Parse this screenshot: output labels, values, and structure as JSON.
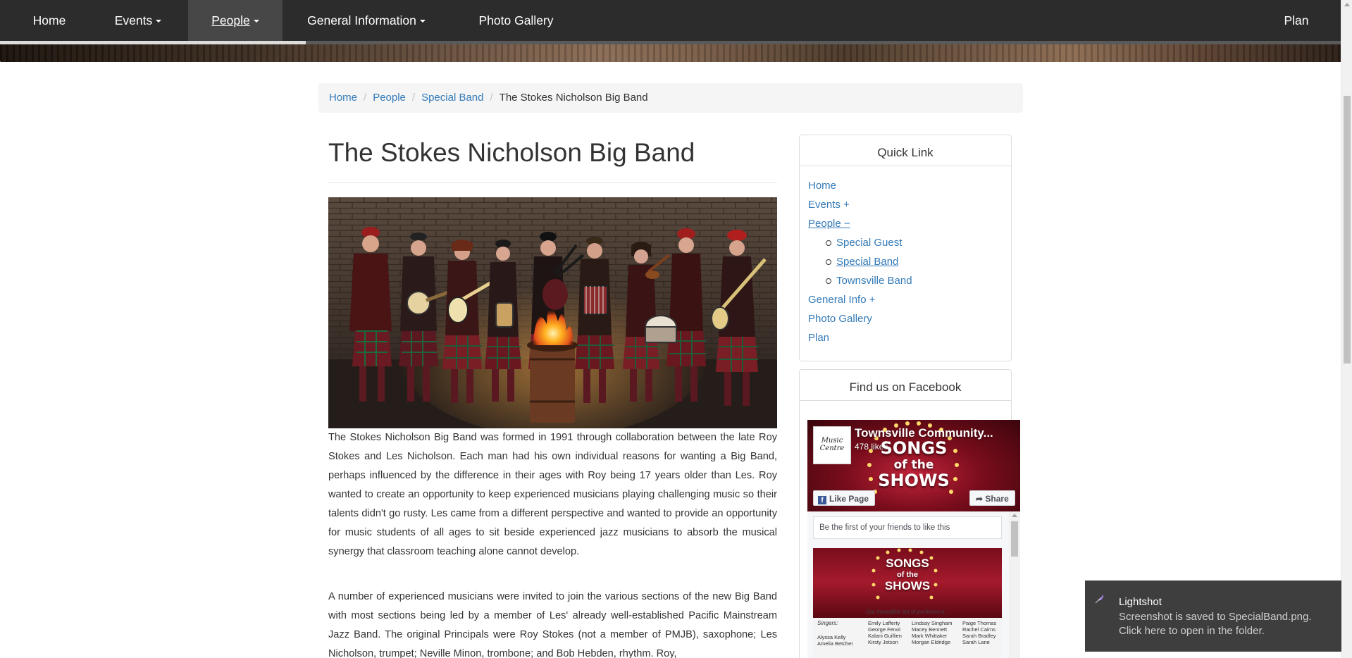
{
  "nav": {
    "items": [
      {
        "label": "Home",
        "has_caret": false
      },
      {
        "label": "Events",
        "has_caret": true
      },
      {
        "label": "People",
        "has_caret": true,
        "active": true
      },
      {
        "label": "General Information",
        "has_caret": true
      },
      {
        "label": "Photo Gallery",
        "has_caret": false
      }
    ],
    "right_item": "Plan",
    "page_progress": 0.228
  },
  "breadcrumb": {
    "items": [
      "Home",
      "People",
      "Special Band"
    ],
    "current": "The Stokes Nicholson Big Band"
  },
  "main": {
    "title": "The Stokes Nicholson Big Band",
    "paragraphs": [
      "The Stokes Nicholson Big Band was formed in 1991 through collaboration between the late Roy Stokes and Les Nicholson. Each man had his own individual reasons for wanting a Big Band, perhaps influenced by the difference in their ages with Roy being 17 years older than Les. Roy wanted to create an opportunity to keep experienced musicians playing challenging music so their talents didn't go rusty. Les came from a different perspective and wanted to provide an opportunity for music students of all ages to sit beside experienced jazz musicians to absorb the musical synergy that classroom teaching alone cannot develop.",
      "A number of experienced musicians were invited to join the various sections of the new Big Band with most sections being led by a member of Les' already well-established Pacific Mainstream Jazz Band. The original Principals were Roy Stokes (not a member of PMJB), saxophone; Les Nicholson, trumpet; Neville Minon, trombone; and Bob Hebden, rhythm. Roy,"
    ]
  },
  "sidebar": {
    "quick_link": {
      "heading": "Quick Link",
      "items": [
        {
          "label": "Home",
          "level": 0
        },
        {
          "label": "Events +",
          "level": 0
        },
        {
          "label": "People −",
          "level": 0,
          "active": true
        },
        {
          "label": "Special Guest",
          "level": 1
        },
        {
          "label": "Special Band",
          "level": 1,
          "active": true
        },
        {
          "label": "Townsville Band",
          "level": 1
        },
        {
          "label": "General Info +",
          "level": 0
        },
        {
          "label": "Photo Gallery",
          "level": 0
        },
        {
          "label": "Plan",
          "level": 0
        }
      ]
    },
    "facebook": {
      "heading": "Find us on Facebook",
      "page_name": "Townsville Community...",
      "likes": "478 likes",
      "logo_text": "Music Centre",
      "cover_text_1": "SONGS",
      "cover_text_2": "of the",
      "cover_text_3": "SHOWS",
      "like_button": "Like Page",
      "share_button": "Share",
      "friends_text": "Be the first of your friends to like this",
      "post": {
        "title_1": "SONGS",
        "title_2": "of the",
        "title_3": "SHOWS",
        "subtitle": "Our incredible list of performers...",
        "singers_label": "Singers:",
        "col1": [
          "Alyssa Kelly",
          "Amelia Betcher"
        ],
        "col2": [
          "Emily Lafferty",
          "George Fenol",
          "Kalani Guillien",
          "Kirsty Jetson"
        ],
        "col3": [
          "Lindsay Singham",
          "Macey Bennett",
          "Mark Whittaker",
          "Morgan Eldridge"
        ],
        "col4": [
          "Paige Thomas",
          "Rachel Cairns",
          "Sarah Bradley",
          "Sarah Lane"
        ]
      }
    }
  },
  "toast": {
    "title": "Lightshot",
    "line1": "Screenshot is saved to SpecialBand.png.",
    "line2": "Click here to open in the folder."
  },
  "colors": {
    "navbar": "#2c2c2c",
    "link": "#337ab7",
    "toast": "#3e3e3e",
    "facebook_blue": "#3b5998"
  }
}
